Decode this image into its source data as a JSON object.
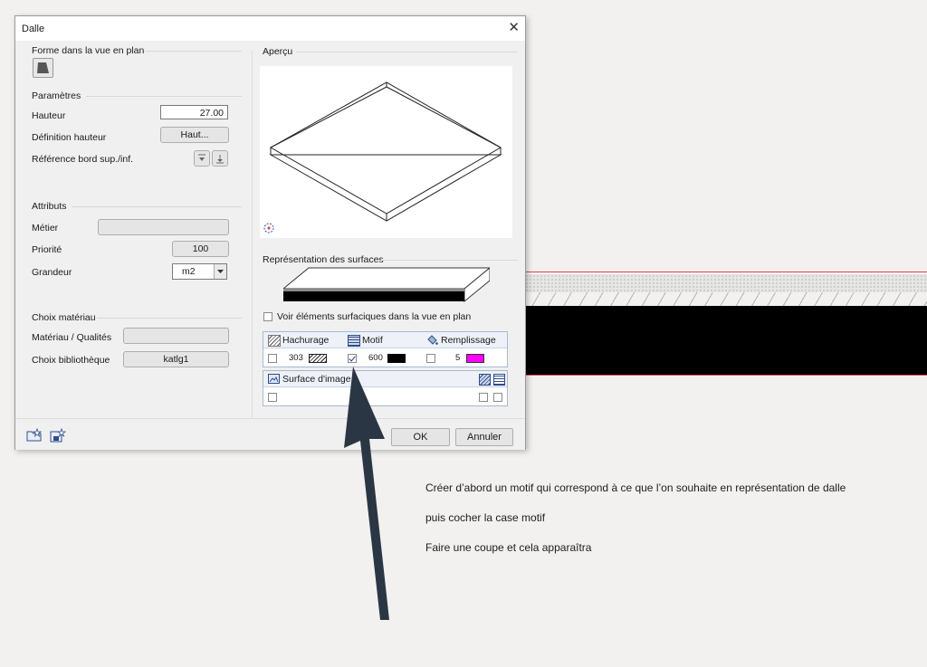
{
  "dialog": {
    "title": "Dalle",
    "close_glyph": "✕"
  },
  "forme": {
    "group_label": "Forme dans la vue en plan",
    "shape_icon": "slab-shape-icon"
  },
  "parametres": {
    "group_label": "Paramètres",
    "hauteur_label": "Hauteur",
    "hauteur_value": "27.00",
    "definition_label": "Définition hauteur",
    "definition_button": "Haut...",
    "reference_label": "Référence bord sup./inf."
  },
  "attributs": {
    "group_label": "Attributs",
    "metier_label": "Métier",
    "metier_value": "",
    "priorite_label": "Priorité",
    "priorite_value": "100",
    "grandeur_label": "Grandeur",
    "grandeur_value": "m2"
  },
  "materiau": {
    "group_label": "Choix matériau",
    "qualites_label": "Matériau / Qualités",
    "qualites_value": "",
    "bibliotheque_label": "Choix bibliothèque",
    "bibliotheque_value": "katlg1"
  },
  "apercu": {
    "group_label": "Aperçu"
  },
  "surfaces": {
    "group_label": "Représentation des surfaces",
    "voir_label": "Voir éléments surfaciques dans la vue en plan",
    "voir_checked": false,
    "col_hachurage": "Hachurage",
    "col_motif": "Motif",
    "col_remplissage": "Remplissage",
    "hachurage_value": "303",
    "hachurage_checked": false,
    "motif_value": "600",
    "motif_checked": true,
    "motif_color": "#000000",
    "remplissage_value": "5",
    "remplissage_checked": false,
    "remplissage_color": "#ff00ff",
    "surface_image_label": "Surface d'image"
  },
  "footer": {
    "ok_label": "OK",
    "cancel_label": "Annuler"
  },
  "notes": {
    "line1": "Créer d’abord un motif qui correspond à ce que l’on souhaite en représentation de dalle",
    "line2": "puis cocher  la case motif",
    "line3": "Faire une coupe et cela apparaîtra"
  },
  "colors": {
    "arrow": "#2b3645",
    "cad_red": "#e0474f",
    "magenta": "#ff00ff"
  }
}
